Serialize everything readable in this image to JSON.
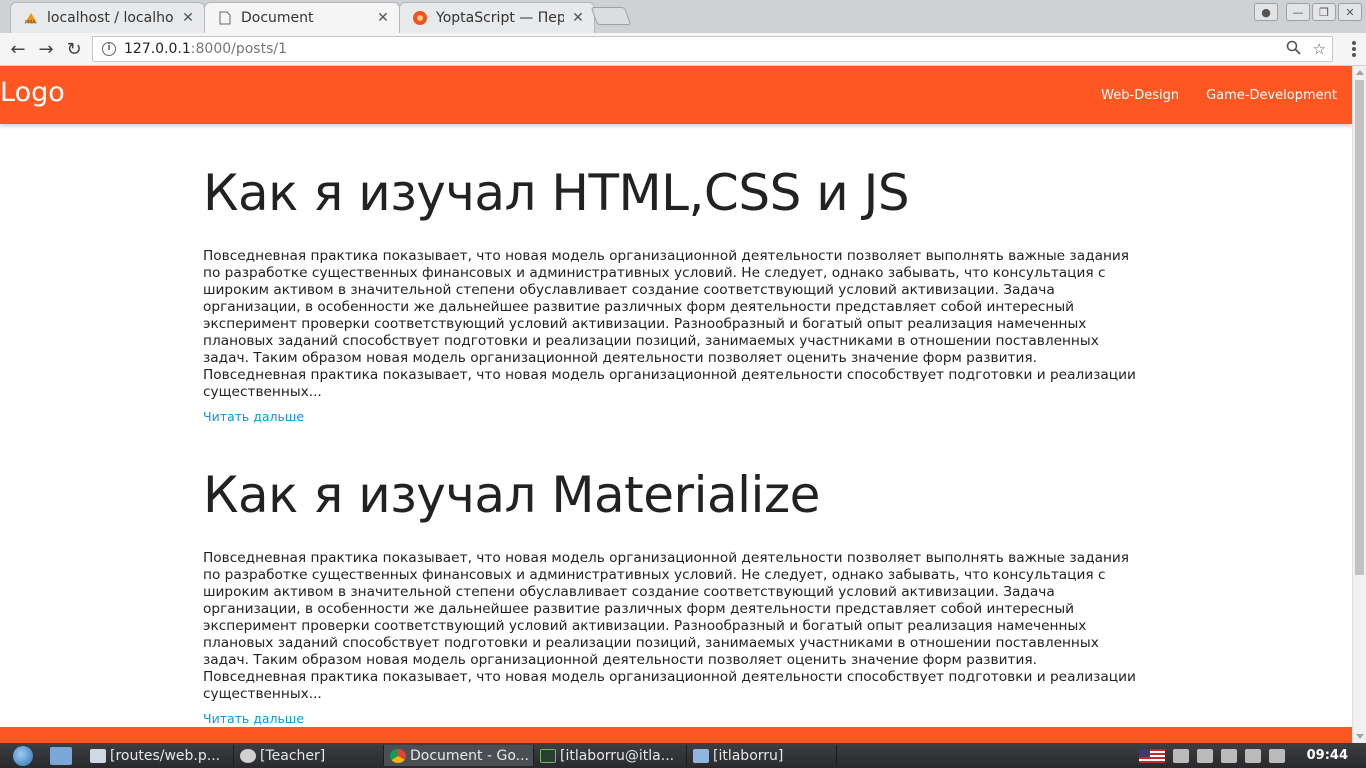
{
  "browser": {
    "tabs": [
      {
        "title": "localhost / localhost",
        "active": false
      },
      {
        "title": "Document",
        "active": true
      },
      {
        "title": "YoptaScript — Перевод",
        "active": false
      }
    ],
    "url_host": "127.0.0.1",
    "url_path": ":8000/posts/1"
  },
  "navbar": {
    "logo": "Logo",
    "links": [
      "Web-Design",
      "Game-Development"
    ],
    "color": "#ff5722"
  },
  "posts": [
    {
      "title": "Как я изучал HTML,CSS и JS",
      "body": "Повседневная практика показывает, что новая модель организационной деятельности позволяет выполнять важные задания по разработке существенных финансовых и административных условий. Не следует, однако забывать, что консультация с широким активом в значительной степени обуславливает создание соответствующий условий активизации. Задача организации, в особенности же дальнейшее развитие различных форм деятельности представляет собой интересный эксперимент проверки соответствующий условий активизации. Разнообразный и богатый опыт реализация намеченных плановых заданий способствует подготовки и реализации позиций, занимаемых участниками в отношении поставленных задач. Таким образом новая модель организационной деятельности позволяет оценить значение форм развития. Повседневная практика показывает, что новая модель организационной деятельности способствует подготовки и реализации существенных...",
      "read_more": "Читать дальше"
    },
    {
      "title": "Как я изучал Materialize",
      "body": "Повседневная практика показывает, что новая модель организационной деятельности позволяет выполнять важные задания по разработке существенных финансовых и административных условий. Не следует, однако забывать, что консультация с широким активом в значительной степени обуславливает создание соответствующий условий активизации. Задача организации, в особенности же дальнейшее развитие различных форм деятельности представляет собой интересный эксперимент проверки соответствующий условий активизации. Разнообразный и богатый опыт реализация намеченных плановых заданий способствует подготовки и реализации позиций, занимаемых участниками в отношении поставленных задач. Таким образом новая модель организационной деятельности позволяет оценить значение форм развития. Повседневная практика показывает, что новая модель организационной деятельности способствует подготовки и реализации существенных...",
      "read_more": "Читать дальше"
    }
  ],
  "taskbar": {
    "tasks": [
      "[routes/web.p...",
      "[Teacher]",
      "Document - Go...",
      "[itlaborru@itla...",
      "[itlaborru]"
    ],
    "clock": "09:44"
  }
}
